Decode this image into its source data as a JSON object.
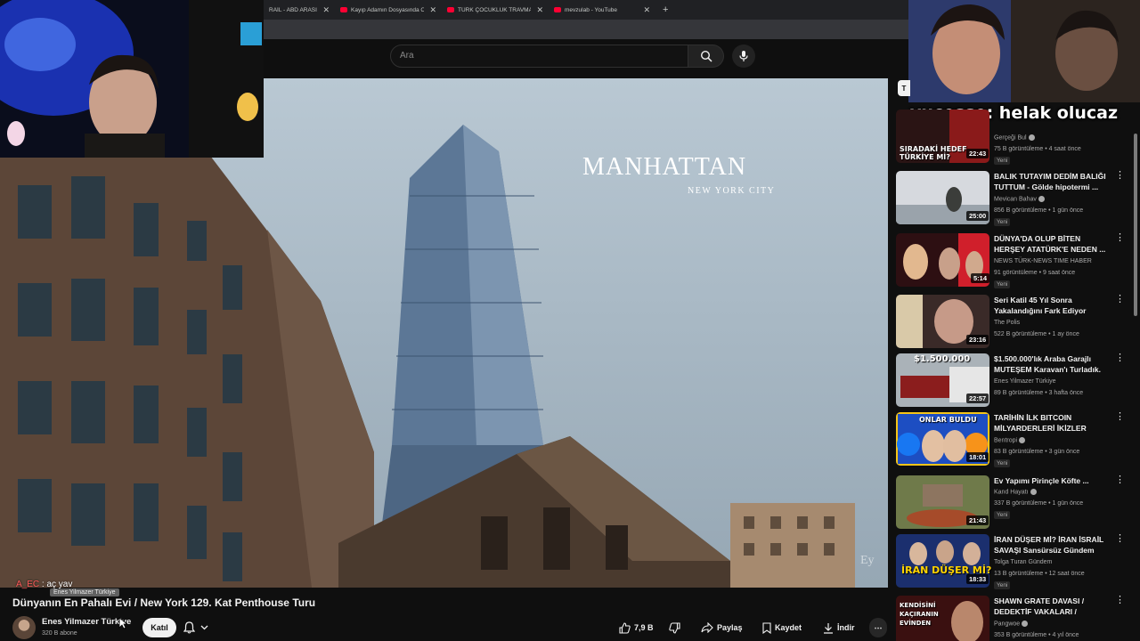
{
  "browser": {
    "tabs": [
      {
        "label": "RAİL - ABD ARASINDA"
      },
      {
        "label": "Kayıp Adamın Dosyasında Orta"
      },
      {
        "label": "TÜRK ÇOCUKLUK TRAVMALARI"
      },
      {
        "label": "mevzulab - YouTube"
      }
    ],
    "new_tab": "+"
  },
  "search": {
    "placeholder": "Ara"
  },
  "video": {
    "overlay_title": "MANHATTAN",
    "overlay_subtitle": "NEW YORK CITY",
    "watermark": "Ey",
    "title": "Dünyanın En Pahalı Evi / New York 129. Kat Penthouse Turu",
    "channel": "Enes Yilmazer Türkiye",
    "channel_tooltip": "Enes Yilmazer Türkiye",
    "subscribers": "320 B abone",
    "join_label": "Katıl",
    "likes": "7,9 B",
    "share_label": "Paylaş",
    "save_label": "Kaydet",
    "download_label": "İndir"
  },
  "stream_chat": {
    "big_user": "yucesse",
    "big_message": ": helak olucaz",
    "small_user": "A_EC",
    "small_message": " : aç yav"
  },
  "sidebar": {
    "chip": "T",
    "recommendations": [
      {
        "title": "",
        "thumb_text": "SIRADAKİ HEDEF TÜRKİYE Mİ?",
        "channel": "Gerçeği Bul",
        "verified": true,
        "meta": "75 B görüntüleme • 4 saat önce",
        "badge": "Yeni",
        "duration": "22:43"
      },
      {
        "title": "BALIK TUTAYIM DEDİM BALIĞI TUTTUM - Gölde hipotermi ...",
        "thumb_text": "",
        "channel": "Mevican Bahav",
        "verified": true,
        "meta": "856 B görüntüleme • 1 gün önce",
        "badge": "Yeni",
        "duration": "25:00"
      },
      {
        "title": "DÜNYA'DA OLUP BİTEN HERŞEY ATATÜRK'E NEDEN ...",
        "thumb_text": "",
        "channel": "NEWS TÜRK-NEWS TIME HABER",
        "verified": false,
        "meta": "91 görüntüleme • 9 saat önce",
        "badge": "Yeni",
        "duration": "5:14"
      },
      {
        "title": "Seri Katil 45 Yıl Sonra Yakalandığını Fark Ediyor",
        "thumb_text": "",
        "channel": "The Polis",
        "verified": false,
        "meta": "522 B görüntüleme • 1 ay önce",
        "badge": "",
        "duration": "23:16"
      },
      {
        "title": "$1.500.000'lık Araba Garajlı MUTEŞEM Karavan'ı Turladık.",
        "thumb_text": "$1.500.000",
        "channel": "Enes Yilmazer Türkiye",
        "verified": false,
        "meta": "89 B görüntüleme • 3 hafta önce",
        "badge": "",
        "duration": "22:57"
      },
      {
        "title": "TARİHİN İLK BITCOIN MİLYARDERLERİ İKİZLER",
        "thumb_text": "ONLAR BULDU",
        "channel": "Bentropi",
        "verified": true,
        "meta": "83 B görüntüleme • 3 gün önce",
        "badge": "Yeni",
        "duration": "18:01"
      },
      {
        "title": "Ev Yapımı Pirinçle Köfte ...",
        "thumb_text": "",
        "channel": "Kand Hayatı",
        "verified": true,
        "meta": "337 B görüntüleme • 1 gün önce",
        "badge": "Yeni",
        "duration": "21:43"
      },
      {
        "title": "İRAN DÜŞER Mİ? İRAN İSRAİL SAVAŞI Sansürsüz Gündem",
        "thumb_text": "İRAN DÜŞER Mİ?",
        "channel": "Tolga Turan Gündem",
        "verified": false,
        "meta": "13 B görüntüleme • 12 saat önce",
        "badge": "Yeni",
        "duration": "18:33"
      },
      {
        "title": "SHAWN GRATE DAVASI / DEDEKTİF VAKALARI /",
        "thumb_text": "KENDİSİNİ KAÇIRANIN EVİNDEN",
        "channel": "Pangwoe",
        "verified": true,
        "meta": "353 B görüntüleme • 4 yıl önce",
        "badge": "",
        "duration": ""
      }
    ]
  }
}
